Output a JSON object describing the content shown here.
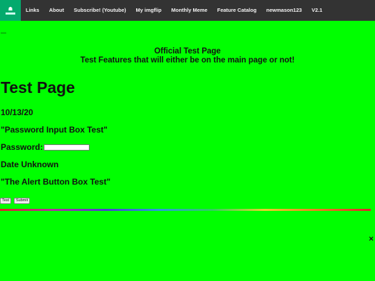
{
  "nav": {
    "logo_text": "☗",
    "items": [
      {
        "label": "Links"
      },
      {
        "label": "About"
      },
      {
        "label": "Subscribe! (Youtube)"
      },
      {
        "label": "My imgflip"
      },
      {
        "label": "Monthly Meme"
      },
      {
        "label": "Feature Catalog"
      },
      {
        "label": "newmason123"
      },
      {
        "label": "V2.1"
      }
    ]
  },
  "page": {
    "dash": "—",
    "center_title": "Official Test Page",
    "center_subtitle": "Test Features that will either be on the main page or not!",
    "heading": "Test Page",
    "date1": "10/13/20",
    "test1_title": "\"Password Input Box Test\"",
    "password_label": "Password:",
    "password_value": "",
    "date2": "Date Unknown",
    "test2_title": "\"The Alert Button Box Test\"",
    "button_test": "Test",
    "button_submit": "Submit",
    "close_glyph": "×"
  },
  "colors": {
    "background": "#00ff00",
    "nav_background": "#333333",
    "logo_green": "#04aa6d"
  }
}
